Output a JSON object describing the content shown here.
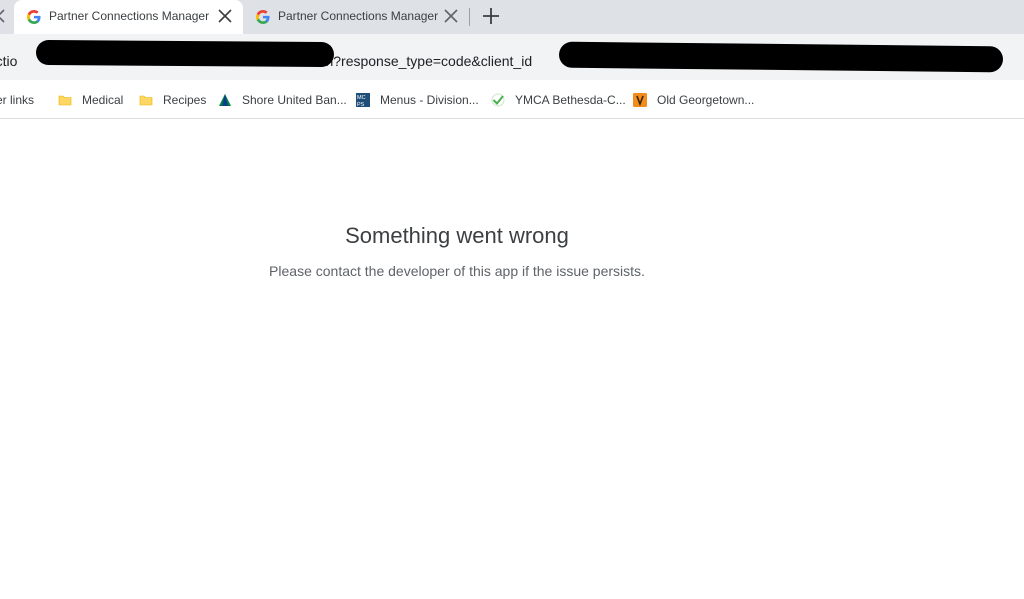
{
  "tabs": [
    {
      "title": "Partner Connections Manager",
      "active": true
    },
    {
      "title": "Partner Connections Manager",
      "active": false
    }
  ],
  "omnibox": {
    "url_start": "nectio",
    "url_middle": "auth?response_type=code&client_id"
  },
  "bookmarks": [
    {
      "label": "er links",
      "icon": "bookmark-icon"
    },
    {
      "label": "Medical",
      "icon": "folder-icon"
    },
    {
      "label": "Recipes",
      "icon": "folder-icon"
    },
    {
      "label": "Shore United Ban...",
      "icon": "shore-united-logo-icon"
    },
    {
      "label": "Menus - Division...",
      "icon": "mcps-logo-icon"
    },
    {
      "label": "YMCA Bethesda-C...",
      "icon": "checkmark-icon"
    },
    {
      "label": "Old Georgetown...",
      "icon": "old-georgetown-icon"
    }
  ],
  "error": {
    "title": "Something went wrong",
    "message": "Please contact the developer of this app if the issue persists."
  },
  "colors": {
    "tabstrip": "#dee1e6",
    "toolbar": "#f1f3f4",
    "folder": "#fdd663",
    "text": "#3c4043"
  }
}
